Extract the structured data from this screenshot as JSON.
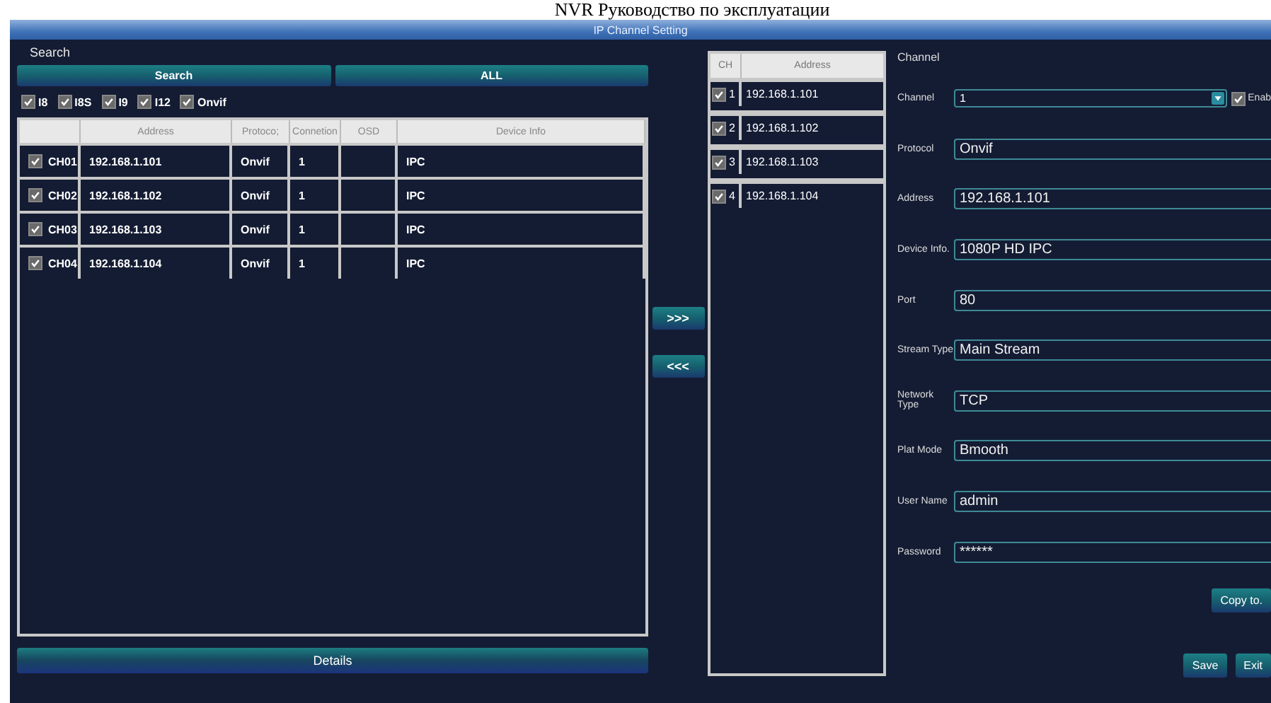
{
  "document_header": "NVR Руководство по эксплуатации",
  "window": {
    "title": "IP Channel Setting"
  },
  "search": {
    "label": "Search",
    "buttons": [
      "Search",
      "ALL"
    ],
    "filters": [
      {
        "label": "I8",
        "checked": true
      },
      {
        "label": "I8S",
        "checked": true
      },
      {
        "label": "I9",
        "checked": true
      },
      {
        "label": "I12",
        "checked": true
      },
      {
        "label": "Onvif",
        "checked": true
      }
    ]
  },
  "device_table": {
    "columns": [
      "Address",
      "Protoco;",
      "Connetion",
      "OSD",
      "Device Info"
    ],
    "rows": [
      {
        "channel": "CH01",
        "checked": true,
        "address": "192.168.1.101",
        "protocol": "Onvif",
        "connection": "1",
        "device_info": "IPC"
      },
      {
        "channel": "CH02",
        "checked": true,
        "address": "192.168.1.102",
        "protocol": "Onvif",
        "connection": "1",
        "device_info": "IPC"
      },
      {
        "channel": "CH03",
        "checked": true,
        "address": "192.168.1.103",
        "protocol": "Onvif",
        "connection": "1",
        "device_info": "IPC"
      },
      {
        "channel": "CH04",
        "checked": true,
        "address": "192.168.1.104",
        "protocol": "Onvif",
        "connection": "1",
        "device_info": "IPC"
      }
    ]
  },
  "move_buttons": [
    ">>>",
    "<<<"
  ],
  "details_button": "Details",
  "channel_list": {
    "columns": [
      "CH",
      "Address"
    ],
    "rows": [
      {
        "ch": "1",
        "checked": true,
        "address": "192.168.1.101"
      },
      {
        "ch": "2",
        "checked": true,
        "address": "192.168.1.102"
      },
      {
        "ch": "3",
        "checked": true,
        "address": "192.168.1.103"
      },
      {
        "ch": "4",
        "checked": true,
        "address": "192.168.1.104"
      }
    ]
  },
  "channel_form": {
    "title": "Channel",
    "channel": {
      "label": "Channel",
      "value": "1",
      "enable_label": "Enab",
      "enabled": true
    },
    "fields": [
      {
        "label": "Protocol",
        "value": "Onvif"
      },
      {
        "label": "Address",
        "value": "192.168.1.101"
      },
      {
        "label": "Device Info.",
        "value": "1080P HD IPC"
      },
      {
        "label": "Port",
        "value": "80"
      },
      {
        "label": "Stream Type",
        "value": "Main Stream"
      },
      {
        "label": "Network Type",
        "value": "TCP"
      },
      {
        "label": "Plat Mode",
        "value": "Bmooth"
      },
      {
        "label": "User Name",
        "value": "admin"
      },
      {
        "label": "Password",
        "value": "******"
      }
    ],
    "copy_button": "Copy to.",
    "actions": [
      "Save",
      "Exit"
    ]
  }
}
